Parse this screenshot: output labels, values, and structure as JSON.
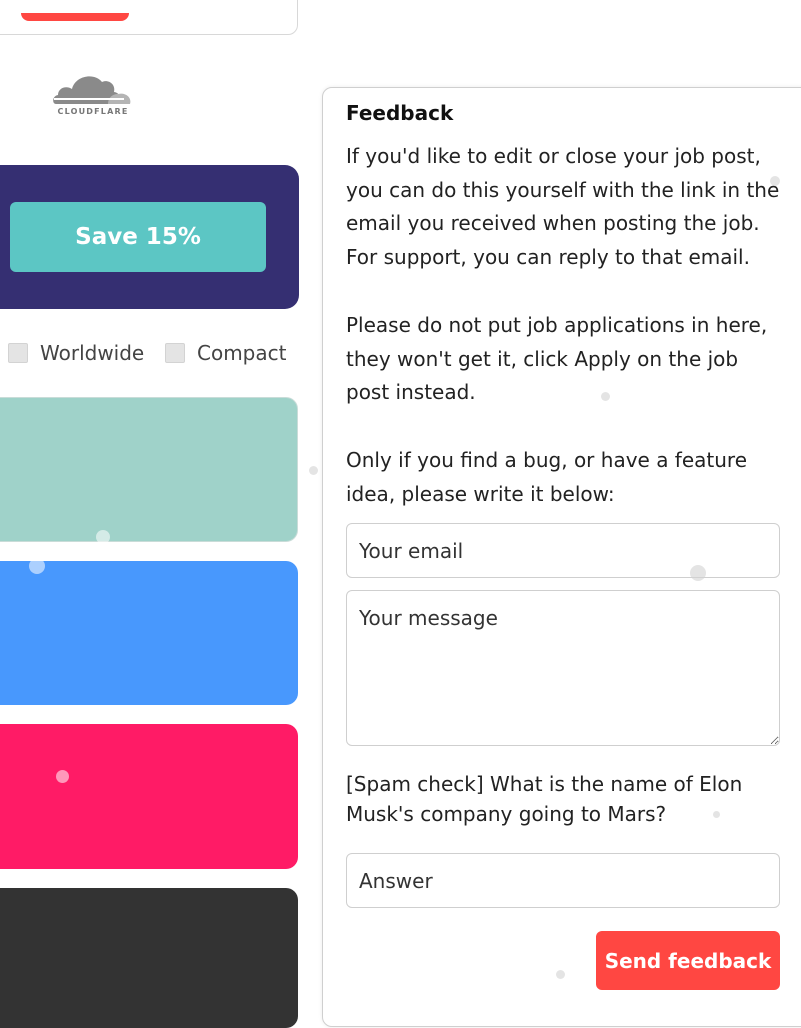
{
  "left": {
    "logo_text": "CLOUDFLARE",
    "promo_button": "Save 15%",
    "filters": [
      {
        "label": "Worldwide"
      },
      {
        "label": "Compact"
      }
    ]
  },
  "feedback": {
    "title": "Feedback",
    "paragraph1": "If you'd like to edit or close your job post, you can do this yourself with the link in the email you received when posting the job. For support, you can reply to that email.",
    "paragraph2": "Please do not put job applications in here, they won't get it, click Apply on the job post instead.",
    "paragraph3": "Only if you find a bug, or have a feature idea, please write it below:",
    "email_placeholder": "Your email",
    "message_placeholder": "Your message",
    "spam_question": "[Spam check] What is the name of Elon Musk's company going to Mars?",
    "answer_placeholder": "Answer",
    "send_label": "Send feedback"
  },
  "colors": {
    "promo_bg": "#352f72",
    "promo_button": "#5cc6c4",
    "card_teal": "#9fd2c9",
    "card_blue": "#4898fd",
    "card_pink": "#ff1b66",
    "card_dark": "#333333",
    "send_button": "#ff4742"
  }
}
